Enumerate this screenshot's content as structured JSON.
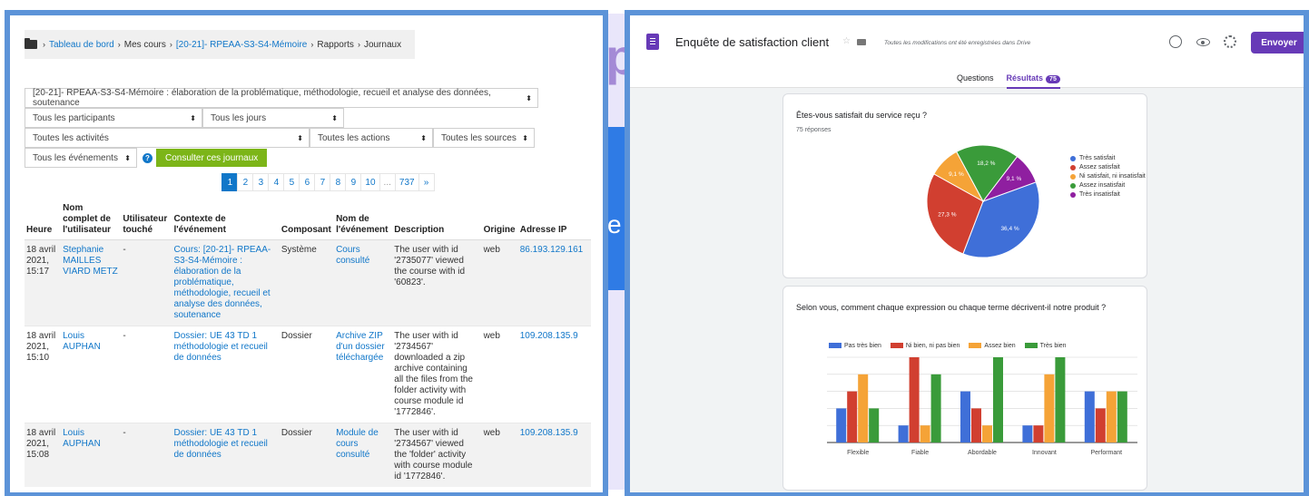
{
  "moodle": {
    "breadcrumb": [
      "Tableau de bord",
      "Mes cours",
      "[20-21]- RPEAA-S3-S4-Mémoire",
      "Rapports",
      "Journaux"
    ],
    "filters": {
      "course": "[20-21]- RPEAA-S3-S4-Mémoire : élaboration de la problématique, méthodologie, recueil et analyse des données, soutenance",
      "participants": "Tous les participants",
      "days": "Tous les jours",
      "activities": "Toutes les activités",
      "actions": "Toutes les actions",
      "sources": "Toutes les sources",
      "events": "Tous les événements",
      "submit": "Consulter ces journaux"
    },
    "pagination": [
      "1",
      "2",
      "3",
      "4",
      "5",
      "6",
      "7",
      "8",
      "9",
      "10",
      "...",
      "737",
      "»"
    ],
    "columns": [
      "Heure",
      "Nom complet de l'utilisateur",
      "Utilisateur touché",
      "Contexte de l'événement",
      "Composant",
      "Nom de l'événement",
      "Description",
      "Origine",
      "Adresse IP"
    ],
    "rows": [
      {
        "time": "18 avril 2021, 15:17",
        "user": "Stephanie MAILLES VIARD METZ",
        "affected": "-",
        "context": "Cours: [20-21]- RPEAA-S3-S4-Mémoire : élaboration de la problématique, méthodologie, recueil et analyse des données, soutenance",
        "component": "Système",
        "event": "Cours consulté",
        "description": "The user with id '2735077' viewed the course with id '60823'.",
        "origin": "web",
        "ip": "86.193.129.161"
      },
      {
        "time": "18 avril 2021, 15:10",
        "user": "Louis AUPHAN",
        "affected": "-",
        "context": "Dossier: UE 43 TD 1 méthodologie et recueil de données",
        "component": "Dossier",
        "event": "Archive ZIP d'un dossier téléchargée",
        "description": "The user with id '2734567' downloaded a zip archive containing all the files from the folder activity with course module id '1772846'.",
        "origin": "web",
        "ip": "109.208.135.9"
      },
      {
        "time": "18 avril 2021, 15:08",
        "user": "Louis AUPHAN",
        "affected": "-",
        "context": "Dossier: UE 43 TD 1 méthodologie et recueil de données",
        "component": "Dossier",
        "event": "Module de cours consulté",
        "description": "The user with id '2734567' viewed the 'folder' activity with course module id '1772846'.",
        "origin": "web",
        "ip": "109.208.135.9"
      }
    ]
  },
  "forms": {
    "title": "Enquête de satisfaction client",
    "saved_note": "Toutes les modifications ont été enregistrées dans Drive",
    "send_label": "Envoyer",
    "tabs": {
      "questions": "Questions",
      "results": "Résultats",
      "count": "75"
    },
    "colors": {
      "blue": "#3f6fd8",
      "red": "#d13f30",
      "orange": "#f5a337",
      "green": "#3a9b3a",
      "purple": "#8f1fa0",
      "accent": "#673ab7"
    }
  },
  "chart_data": [
    {
      "type": "pie",
      "title": "Êtes-vous satisfait du service reçu ?",
      "subtitle": "75 réponses",
      "labels": [
        "Très satisfait",
        "Assez satisfait",
        "Ni satisfait, ni insatisfait",
        "Assez insatisfait",
        "Très insatisfait"
      ],
      "values": [
        36.4,
        27.3,
        9.1,
        18.2,
        9.1
      ],
      "value_labels": [
        "36,4 %",
        "27,3 %",
        "9,1 %",
        "18,2 %",
        "9,1 %"
      ],
      "colors": [
        "#3f6fd8",
        "#d13f30",
        "#f5a337",
        "#3a9b3a",
        "#8f1fa0"
      ],
      "legend": "right"
    },
    {
      "type": "bar",
      "title": "Selon vous, comment chaque expression ou chaque terme décrivent-il notre produit ?",
      "categories": [
        "Flexible",
        "Fiable",
        "Abordable",
        "Innovant",
        "Performant"
      ],
      "series": [
        {
          "name": "Pas très bien",
          "values": [
            2,
            1,
            3,
            1,
            3
          ]
        },
        {
          "name": "Ni bien, ni pas bien",
          "values": [
            3,
            5,
            2,
            1,
            2
          ]
        },
        {
          "name": "Assez bien",
          "values": [
            4,
            1,
            1,
            4,
            3
          ]
        },
        {
          "name": "Très bien",
          "values": [
            2,
            4,
            5,
            5,
            3
          ]
        }
      ],
      "colors": [
        "#3f6fd8",
        "#d13f30",
        "#f5a337",
        "#3a9b3a"
      ],
      "ylim": [
        0,
        5
      ],
      "grid": true,
      "legend": "top"
    }
  ]
}
